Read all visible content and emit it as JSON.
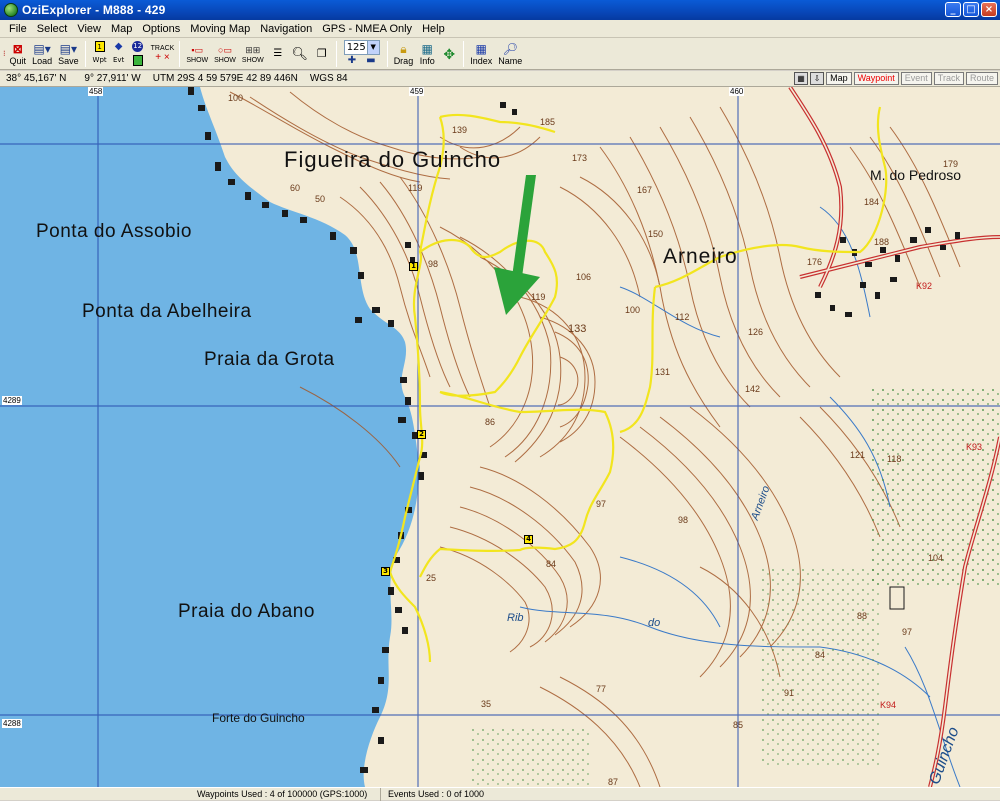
{
  "window": {
    "title": "OziExplorer - M888 - 429"
  },
  "menu": [
    "File",
    "Select",
    "View",
    "Map",
    "Options",
    "Moving Map",
    "Navigation",
    "GPS - NMEA Only",
    "Help"
  ],
  "toolbar": {
    "quit": "Quit",
    "load": "Load",
    "save": "Save",
    "wpt": "Wpt",
    "evt": "Evt",
    "track": "TRACK",
    "show1": "SHOW",
    "show2": "SHOW",
    "show3": "SHOW",
    "zoom_value": "125",
    "drag": "Drag",
    "info": "Info",
    "index": "Index",
    "name": "Name"
  },
  "infobar": {
    "lat": "38° 45,167' N",
    "lon": "9° 27,911' W",
    "utm": "UTM  29S   4 59 579E  42 89 446N",
    "datum": "WGS 84",
    "view_buttons": [
      {
        "label": "Map",
        "state": "normal"
      },
      {
        "label": "Waypoint",
        "state": "active"
      },
      {
        "label": "Event",
        "state": "disabled"
      },
      {
        "label": "Track",
        "state": "disabled"
      },
      {
        "label": "Route",
        "state": "disabled"
      }
    ]
  },
  "map": {
    "place_labels": {
      "figueira": "Figueira  do  Guincho",
      "assobio": "Ponta  do  Assobio",
      "abelheira": "Ponta  da  Abelheira",
      "grota": "Praia  da  Grota",
      "abano": "Praia  do  Abano",
      "arneiro": "Arneiro",
      "pedroso": "M.  do Pedroso",
      "forte": "Forte  do  Guincho",
      "rib": "Rib",
      "rib_do": "do",
      "arneiro_river": "Arneiro",
      "guincho_river": "Guincho"
    },
    "grid_labels": {
      "e458": "458",
      "e459": "459",
      "e460": "460",
      "n4289": "4289",
      "n4288": "4288"
    },
    "spot_heights": [
      "100",
      "139",
      "185",
      "173",
      "167",
      "150",
      "179",
      "184",
      "188",
      "176",
      "119",
      "98",
      "106",
      "133",
      "100",
      "112",
      "126",
      "119",
      "131",
      "142",
      "86",
      "121",
      "118",
      "97",
      "98",
      "104",
      "84",
      "25",
      "88",
      "77",
      "91",
      "84",
      "85",
      "97",
      "87",
      "35",
      "60",
      "50"
    ],
    "road_labels": {
      "k92": "K92",
      "k94": "K94",
      "k93": "K93"
    },
    "waypoints": [
      "1",
      "2",
      "3",
      "4"
    ]
  },
  "status": {
    "waypoints": "Waypoints Used : 4 of 100000  (GPS:1000)",
    "events": "Events Used : 0 of 1000"
  },
  "colors": {
    "sea": "#6fb4e4",
    "land": "#f3ebd6",
    "contour": "#a2582a",
    "route": "#f2e51e",
    "arrow": "#2ba33a",
    "road": "#c83030"
  }
}
